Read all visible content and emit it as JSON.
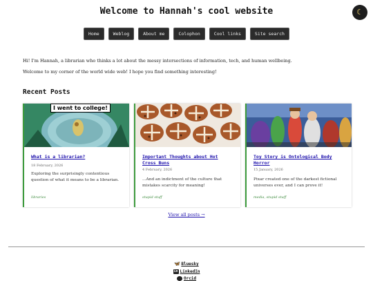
{
  "site": {
    "title": "Welcome to Hannah's cool website",
    "theme_icon": "moon-icon",
    "theme_glyph": "☾"
  },
  "nav": [
    "Home",
    "Weblog",
    "About me",
    "Colophon",
    "Cool links",
    "Site search"
  ],
  "intro": [
    "Hi! I'm Hannah, a librarian who thinks a lot about the messy intersections of information, tech, and human wellbeing.",
    "Welcome to my corner of the world wide web! I hope you find something interesting!"
  ],
  "recent": {
    "heading": "Recent Posts",
    "posts": [
      {
        "title": "What is a librarian?",
        "date": "18 February, 2026",
        "summary": "Exploring the surprisingly contentious question of what it means to be a librarian.",
        "tags": "libraries",
        "image_caption": "I went to college!"
      },
      {
        "title": "Important Thoughts about Hot Cross Buns",
        "date": "4 February, 2026",
        "summary": "...And an indictment of the culture that mistakes scarcity for meaning!",
        "tags": "stupid stuff"
      },
      {
        "title": "Toy Story is Ontological Body Horror",
        "date": "15 January, 2026",
        "summary": "Pixar created one of the darkest fictional universes ever, and I can prove it!",
        "tags": "media, stupid stuff"
      }
    ],
    "view_all": "View all posts →"
  },
  "social": [
    "Bluesky",
    "LinkedIn",
    "Orcid"
  ],
  "colors": {
    "accent_green": "#3c9a3c",
    "link_blue": "#1a0dab",
    "nav_bg": "#2b2b2b"
  }
}
